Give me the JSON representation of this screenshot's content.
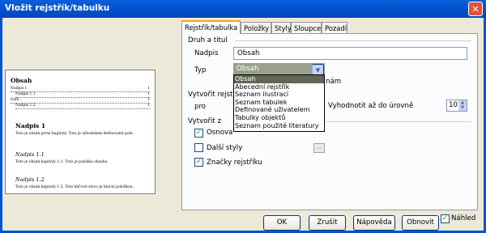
{
  "window": {
    "title": "Vložit rejstřík/tabulku",
    "close_icon": "close-icon"
  },
  "preview": {
    "heading": "Obsah",
    "toc": [
      {
        "label": "Nadpis 1",
        "page": "1"
      },
      {
        "label": "Nadpis 1.1",
        "page": "1"
      },
      {
        "label": "Dalš…",
        "page": "1"
      },
      {
        "label": "Nadpis 1.2",
        "page": "1"
      }
    ],
    "h1": "Nadpis 1",
    "p1": "Toto je obsah první kapitoly. Toto je uživatelem definované pole.",
    "h11": "Nadpis 1.1",
    "p11": "Toto je obsah kapitoly 1.1. Toto je položka obsahu.",
    "h12": "Nadpis 1.2",
    "p12": "Toto je obsah kapitoly 1.2. Toto klíčové slovo je hlavní položkou."
  },
  "tabs": [
    "Rejstřík/tabulka",
    "Položky",
    "Styly",
    "Sloupce",
    "Pozadí"
  ],
  "type_title": {
    "group": "Druh a titul",
    "title_label": "Nadpis",
    "title_value": "Obsah",
    "type_label": "Typ",
    "type_value": "Obsah",
    "type_options": [
      "Obsah",
      "Abecední rejstřík",
      "Seznam ilustrací",
      "Seznam tabulek",
      "Definované uživatelem",
      "Tabulky objektů",
      "Seznam použité literatury"
    ],
    "partial_hidden": "nám"
  },
  "create": {
    "group": "Vytvořit rejstřík",
    "for_label": "pro",
    "evaluate_label": "Vyhodnotit až do úrovně",
    "level": "10"
  },
  "create_from": {
    "group": "Vytvořit z",
    "outline": "Osnova",
    "other_styles": "Další styly",
    "other_styles_btn": "...",
    "index_marks": "Značky rejstříku"
  },
  "buttons": {
    "ok": "OK",
    "cancel": "Zrušit",
    "help": "Nápověda",
    "reset": "Obnovit",
    "preview": "Náhled"
  }
}
